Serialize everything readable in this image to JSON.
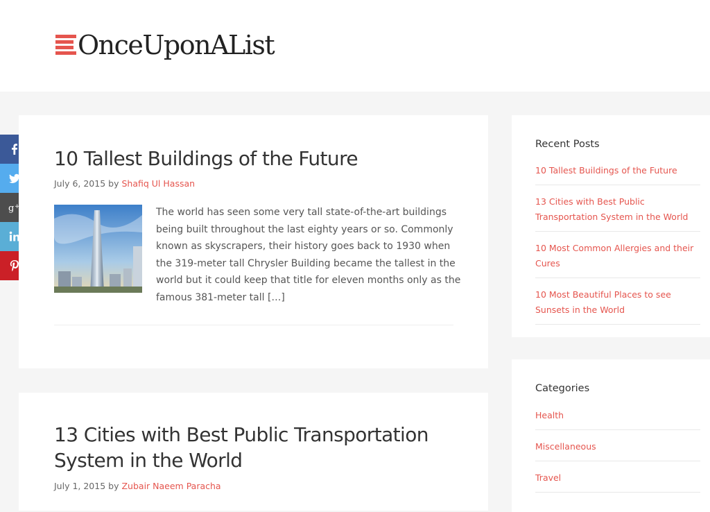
{
  "site": {
    "logo_text": "OnceUponAList",
    "brand_color": "#e5554e"
  },
  "share": [
    {
      "network": "facebook",
      "icon": "facebook-icon",
      "color": "#3b5998"
    },
    {
      "network": "twitter",
      "icon": "twitter-icon",
      "color": "#55acee"
    },
    {
      "network": "google-plus",
      "icon": "google-plus-icon",
      "color": "#4d4d4d"
    },
    {
      "network": "linkedin",
      "icon": "linkedin-icon",
      "color": "#5aaed6"
    },
    {
      "network": "pinterest",
      "icon": "pinterest-icon",
      "color": "#cb2027"
    }
  ],
  "posts": [
    {
      "title": "10 Tallest Buildings of the Future",
      "date": "July 6, 2015",
      "by": "by",
      "author": "Shafiq Ul Hassan",
      "excerpt": "The world has seen some very tall state-of-the-art buildings being built throughout the last eighty years or so. Commonly known as skyscrapers, their history goes back to 1930 when the 319-meter tall Chrysler Building became the tallest in the world but it could keep that title for eleven months only as the famous 381-meter tall […]"
    },
    {
      "title": "13 Cities with Best Public Transportation System in the World",
      "date": "July 1, 2015",
      "by": "by",
      "author": "Zubair Naeem Paracha"
    }
  ],
  "sidebar": {
    "recent": {
      "title": "Recent Posts",
      "items": [
        "10 Tallest Buildings of the Future",
        "13 Cities with Best Public Transportation System in the World",
        "10 Most Common Allergies and their Cures",
        "10 Most Beautiful Places to see Sunsets in the World"
      ]
    },
    "categories": {
      "title": "Categories",
      "items": [
        "Health",
        "Miscellaneous",
        "Travel"
      ]
    }
  }
}
